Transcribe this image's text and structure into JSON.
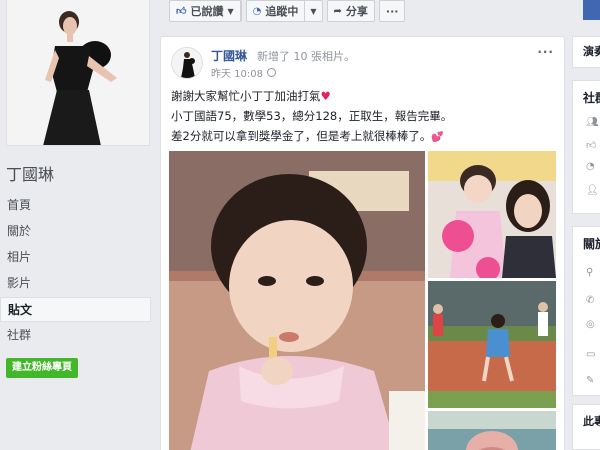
{
  "page": {
    "name": "丁國琳",
    "nav": [
      "首頁",
      "關於",
      "相片",
      "影片",
      "貼文",
      "社群"
    ],
    "active_nav": "貼文",
    "create_page_label": "建立粉絲專頁"
  },
  "topbar": {
    "liked_label": "已說讚",
    "following_label": "追蹤中",
    "share_label": "分享",
    "more_label": "···"
  },
  "post": {
    "author": "丁國琳",
    "action": "新增了 10 張相片。",
    "time": "昨天 10:08",
    "more_label": "···",
    "lines": [
      "謝謝大家幫忙小丁丁加油打氣",
      "小丁國語75，數學53，總分128，正取生，報告完畢。",
      "差2分就可以拿到獎學金了，但是考上就很棒棒了。"
    ]
  },
  "right_column": {
    "button_label": "演奏",
    "community_title": "社群",
    "about_title": "關於",
    "bottom_title": "此專"
  },
  "colors": {
    "facebook_blue": "#4267b2",
    "link_blue": "#365899",
    "green": "#42b72a",
    "heart": "#e0245e",
    "background": "#e9ebee"
  }
}
